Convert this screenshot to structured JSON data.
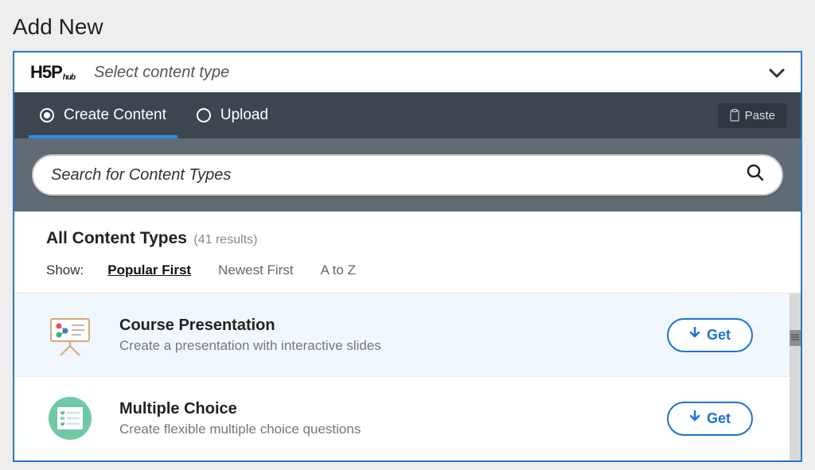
{
  "page": {
    "title": "Add New"
  },
  "hub": {
    "logo_main": "H5P",
    "logo_sub": "hub",
    "select_label": "Select content type"
  },
  "tabs": {
    "create": "Create Content",
    "upload": "Upload",
    "paste": "Paste"
  },
  "search": {
    "placeholder": "Search for Content Types"
  },
  "results": {
    "title": "All Content Types",
    "count": "(41 results)",
    "show_label": "Show:",
    "sort": {
      "popular": "Popular First",
      "newest": "Newest First",
      "atoz": "A to Z"
    }
  },
  "items": [
    {
      "title": "Course Presentation",
      "desc": "Create a presentation with interactive slides",
      "action": "Get"
    },
    {
      "title": "Multiple Choice",
      "desc": "Create flexible multiple choice questions",
      "action": "Get"
    }
  ]
}
